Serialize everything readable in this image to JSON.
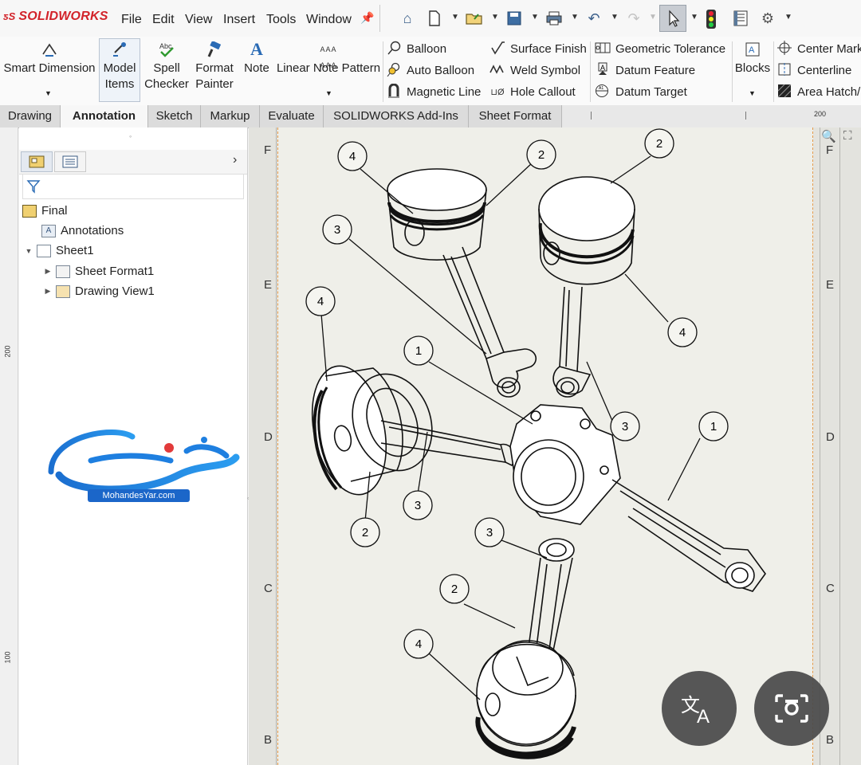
{
  "app": {
    "logo": "SOLIDWORKS"
  },
  "menu": [
    "File",
    "Edit",
    "View",
    "Insert",
    "Tools",
    "Window"
  ],
  "ribbon": {
    "smart_dimension": "Smart Dimension",
    "model_items_1": "Model",
    "model_items_2": "Items",
    "spell_1": "Spell",
    "spell_2": "Checker",
    "format_1": "Format",
    "format_2": "Painter",
    "note": "Note",
    "linear_note_pattern": "Linear Note Pattern",
    "balloon": "Balloon",
    "auto_balloon": "Auto Balloon",
    "magnetic_line": "Magnetic Line",
    "surface_finish": "Surface Finish",
    "weld_symbol": "Weld Symbol",
    "hole_callout": "Hole Callout",
    "geometric_tolerance": "Geometric Tolerance",
    "datum_feature": "Datum Feature",
    "datum_target": "Datum Target",
    "blocks": "Blocks",
    "center_mark": "Center Mark",
    "centerline": "Centerline",
    "area_hatch": "Area Hatch/"
  },
  "tabs": [
    "Drawing",
    "Annotation",
    "Sketch",
    "Markup",
    "Evaluate",
    "SOLIDWORKS Add-Ins",
    "Sheet Format"
  ],
  "active_tab": "Annotation",
  "tree": {
    "root": "Final",
    "annotations": "Annotations",
    "sheet": "Sheet1",
    "sheet_format": "Sheet Format1",
    "drawing_view": "Drawing View1"
  },
  "watermark": {
    "url": "MohandesYar.com"
  },
  "rulers": {
    "top_200": "200",
    "left_200": "200",
    "left_100": "100"
  },
  "zones": [
    "F",
    "E",
    "D",
    "C",
    "B"
  ],
  "balloons": [
    "4",
    "2",
    "2",
    "3",
    "4",
    "4",
    "1",
    "3",
    "1",
    "3",
    "2",
    "3",
    "2",
    "4"
  ],
  "overlay": {
    "translate_icon": "translate-icon",
    "lens_icon": "camera-search-icon"
  }
}
